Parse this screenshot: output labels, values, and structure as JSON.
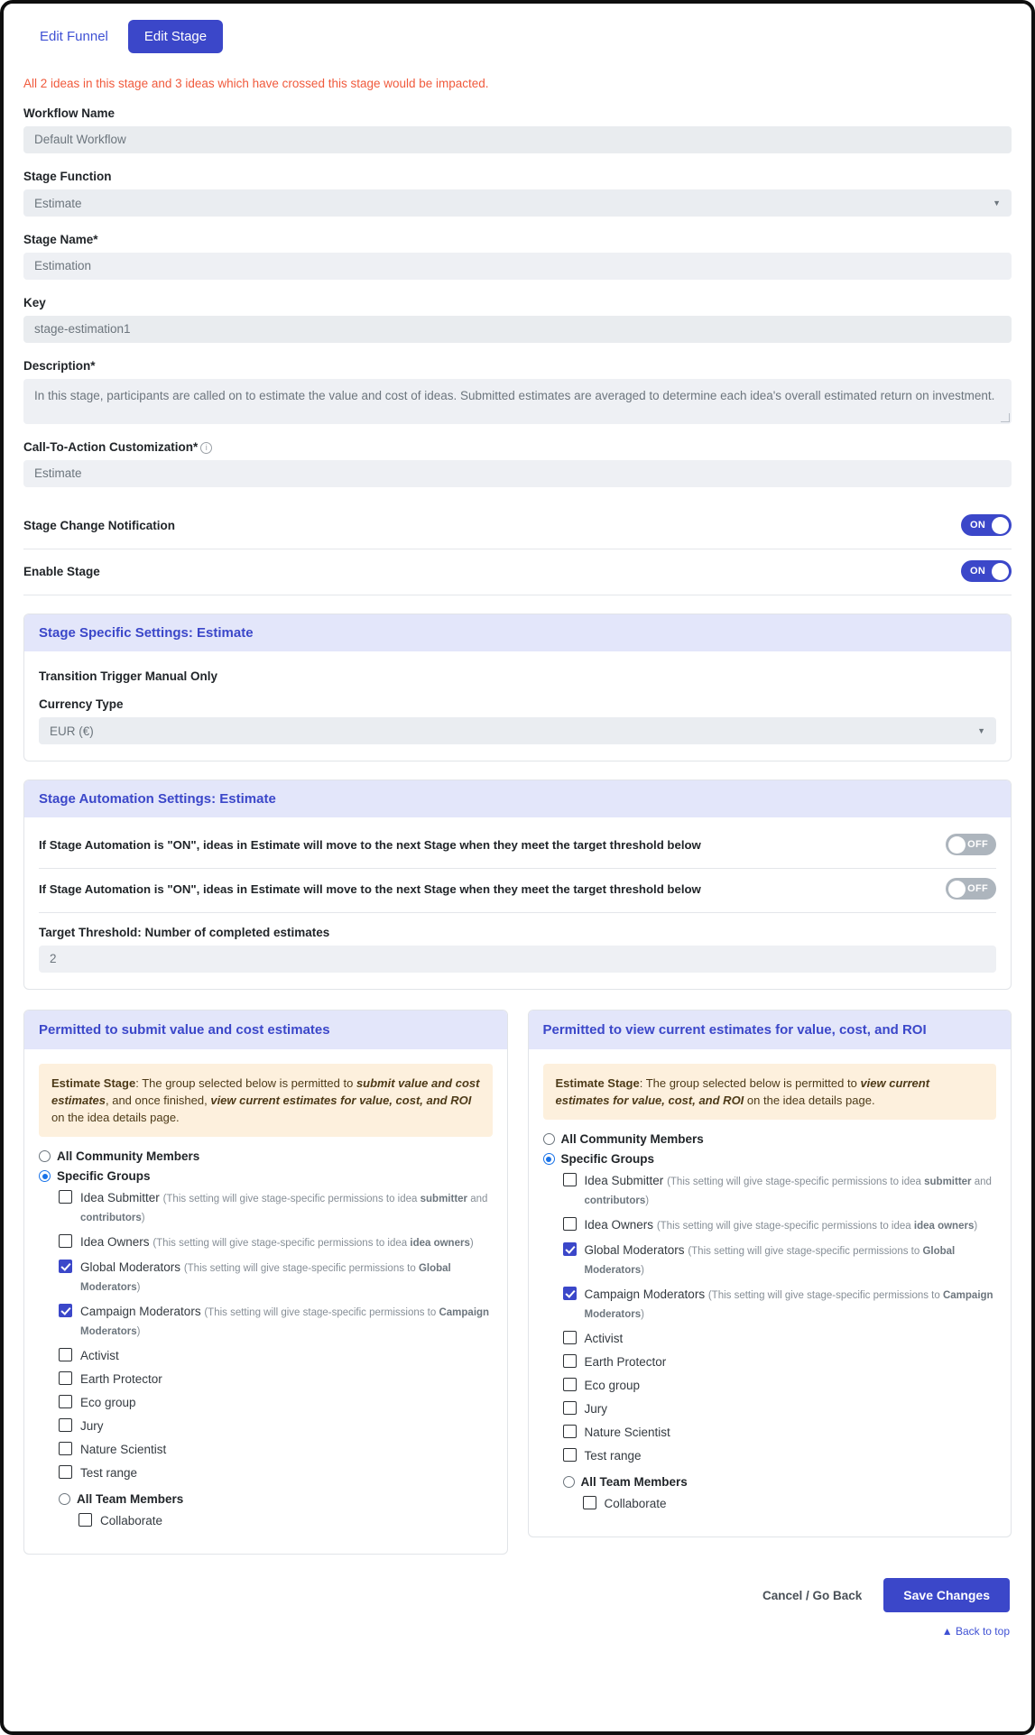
{
  "tabs": [
    {
      "label": "Edit Funnel",
      "active": false
    },
    {
      "label": "Edit Stage",
      "active": true
    }
  ],
  "alert": "All 2 ideas in this stage and 3 ideas which have crossed this stage would be impacted.",
  "form": {
    "workflow_name": {
      "label": "Workflow Name",
      "value": "Default Workflow"
    },
    "stage_function": {
      "label": "Stage Function",
      "value": "Estimate"
    },
    "stage_name": {
      "label": "Stage Name*",
      "value": "Estimation"
    },
    "key": {
      "label": "Key",
      "value": "stage-estimation1"
    },
    "description": {
      "label": "Description*",
      "value": "In this stage, participants are called on to estimate the value and cost of ideas.  Submitted estimates are averaged to determine each idea's overall estimated return on investment."
    },
    "cta": {
      "label": "Call-To-Action Customization*",
      "value": "Estimate",
      "info_icon": "info-icon"
    },
    "stage_change_notification": {
      "label": "Stage Change Notification",
      "state": "ON"
    },
    "enable_stage": {
      "label": "Enable Stage",
      "state": "ON"
    }
  },
  "stage_specific": {
    "title": "Stage Specific Settings: Estimate",
    "transition_trigger": "Transition Trigger Manual Only",
    "currency_label": "Currency Type",
    "currency_value": "EUR (€)"
  },
  "stage_automation": {
    "title": "Stage Automation Settings: Estimate",
    "rows": [
      {
        "label": "If Stage Automation is \"ON\", ideas in Estimate will move to the next Stage when they meet the target threshold below",
        "state": "OFF"
      },
      {
        "label": "If Stage Automation is \"ON\", ideas in Estimate will move to the next Stage when they meet the target threshold below",
        "state": "OFF"
      }
    ],
    "threshold_label": "Target Threshold: Number of completed estimates",
    "threshold_value": "2"
  },
  "permissions_left": {
    "title": "Permitted to submit value and cost estimates",
    "note": {
      "prefix": "Estimate Stage",
      "body1": ": The group selected below is permitted to ",
      "em1": "submit value and cost estimates",
      "body2": ", and once finished, ",
      "em2": "view current estimates for value, cost, and ROI",
      "body3": " on the idea details page."
    },
    "radio_all": {
      "label": "All Community Members",
      "checked": false
    },
    "radio_specific": {
      "label": "Specific Groups",
      "checked": true
    },
    "groups": [
      {
        "name": "Idea Submitter",
        "hint_pre": "(This setting will give stage-specific permissions to idea ",
        "hint_b1": "submitter",
        "hint_mid": " and ",
        "hint_b2": "contributors",
        "hint_post": ")",
        "checked": false
      },
      {
        "name": "Idea Owners",
        "hint_pre": "(This setting will give stage-specific permissions to idea ",
        "hint_b1": "idea owners",
        "hint_mid": "",
        "hint_b2": "",
        "hint_post": ")",
        "checked": false
      },
      {
        "name": "Global Moderators",
        "hint_pre": "(This setting will give stage-specific permissions to ",
        "hint_b1": "Global Moderators",
        "hint_mid": "",
        "hint_b2": "",
        "hint_post": ")",
        "checked": true
      },
      {
        "name": "Campaign Moderators",
        "hint_pre": "(This setting will give stage-specific permissions to ",
        "hint_b1": "Campaign Moderators",
        "hint_mid": "",
        "hint_b2": "",
        "hint_post": ")",
        "checked": true
      },
      {
        "name": "Activist",
        "hint_pre": "",
        "hint_b1": "",
        "hint_mid": "",
        "hint_b2": "",
        "hint_post": "",
        "checked": false
      },
      {
        "name": "Earth Protector",
        "hint_pre": "",
        "hint_b1": "",
        "hint_mid": "",
        "hint_b2": "",
        "hint_post": "",
        "checked": false
      },
      {
        "name": "Eco group",
        "hint_pre": "",
        "hint_b1": "",
        "hint_mid": "",
        "hint_b2": "",
        "hint_post": "",
        "checked": false
      },
      {
        "name": "Jury",
        "hint_pre": "",
        "hint_b1": "",
        "hint_mid": "",
        "hint_b2": "",
        "hint_post": "",
        "checked": false
      },
      {
        "name": "Nature Scientist",
        "hint_pre": "",
        "hint_b1": "",
        "hint_mid": "",
        "hint_b2": "",
        "hint_post": "",
        "checked": false
      },
      {
        "name": "Test range",
        "hint_pre": "",
        "hint_b1": "",
        "hint_mid": "",
        "hint_b2": "",
        "hint_post": "",
        "checked": false
      }
    ],
    "radio_team": {
      "label": "All Team Members",
      "checked": false
    },
    "collaborate": {
      "label": "Collaborate",
      "checked": false
    }
  },
  "permissions_right": {
    "title": "Permitted to view current estimates for value, cost, and ROI",
    "note": {
      "prefix": "Estimate Stage",
      "body1": ": The group selected below is permitted to ",
      "em1": "view current estimates for value, cost, and ROI",
      "body2": " on the idea details page.",
      "em2": "",
      "body3": ""
    },
    "radio_all": {
      "label": "All Community Members",
      "checked": false
    },
    "radio_specific": {
      "label": "Specific Groups",
      "checked": true
    },
    "groups": [
      {
        "name": "Idea Submitter",
        "hint_pre": "(This setting will give stage-specific permissions to idea ",
        "hint_b1": "submitter",
        "hint_mid": " and ",
        "hint_b2": "contributors",
        "hint_post": ")",
        "checked": false
      },
      {
        "name": "Idea Owners",
        "hint_pre": "(This setting will give stage-specific permissions to idea ",
        "hint_b1": "idea owners",
        "hint_mid": "",
        "hint_b2": "",
        "hint_post": ")",
        "checked": false
      },
      {
        "name": "Global Moderators",
        "hint_pre": "(This setting will give stage-specific permissions to ",
        "hint_b1": "Global Moderators",
        "hint_mid": "",
        "hint_b2": "",
        "hint_post": ")",
        "checked": true
      },
      {
        "name": "Campaign Moderators",
        "hint_pre": "(This setting will give stage-specific permissions to ",
        "hint_b1": "Campaign Moderators",
        "hint_mid": "",
        "hint_b2": "",
        "hint_post": ")",
        "checked": true
      },
      {
        "name": "Activist",
        "hint_pre": "",
        "hint_b1": "",
        "hint_mid": "",
        "hint_b2": "",
        "hint_post": "",
        "checked": false
      },
      {
        "name": "Earth Protector",
        "hint_pre": "",
        "hint_b1": "",
        "hint_mid": "",
        "hint_b2": "",
        "hint_post": "",
        "checked": false
      },
      {
        "name": "Eco group",
        "hint_pre": "",
        "hint_b1": "",
        "hint_mid": "",
        "hint_b2": "",
        "hint_post": "",
        "checked": false
      },
      {
        "name": "Jury",
        "hint_pre": "",
        "hint_b1": "",
        "hint_mid": "",
        "hint_b2": "",
        "hint_post": "",
        "checked": false
      },
      {
        "name": "Nature Scientist",
        "hint_pre": "",
        "hint_b1": "",
        "hint_mid": "",
        "hint_b2": "",
        "hint_post": "",
        "checked": false
      },
      {
        "name": "Test range",
        "hint_pre": "",
        "hint_b1": "",
        "hint_mid": "",
        "hint_b2": "",
        "hint_post": "",
        "checked": false
      }
    ],
    "radio_team": {
      "label": "All Team Members",
      "checked": false
    },
    "collaborate": {
      "label": "Collaborate",
      "checked": false
    }
  },
  "footer": {
    "cancel": "Cancel / Go Back",
    "save": "Save Changes",
    "back_to_top": "Back to top",
    "back_to_top_icon": "chevron-up-icon"
  },
  "colors": {
    "brand": "#3b47c9",
    "alert": "#f05a3c",
    "panel_head_bg": "#e3e6fa",
    "note_bg": "#fdf0dd"
  }
}
